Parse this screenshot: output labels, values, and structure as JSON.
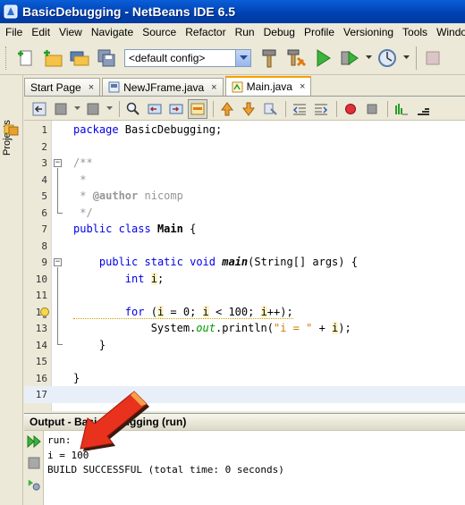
{
  "window": {
    "title": "BasicDebugging - NetBeans IDE 6.5"
  },
  "menu": [
    "File",
    "Edit",
    "View",
    "Navigate",
    "Source",
    "Refactor",
    "Run",
    "Debug",
    "Profile",
    "Versioning",
    "Tools",
    "Window"
  ],
  "toolbar": {
    "config": "<default config>",
    "icons": [
      "new-file-icon",
      "new-project-icon",
      "open-project-icon",
      "save-all-icon",
      "build-hammer-icon",
      "clean-build-icon",
      "run-icon",
      "debug-icon",
      "profile-icon",
      "stop-icon"
    ]
  },
  "sidebar": {
    "projects_label": "Projects"
  },
  "tabs": [
    {
      "label": "Start Page",
      "close": "×",
      "active": false
    },
    {
      "label": "NewJFrame.java",
      "close": "×",
      "active": false
    },
    {
      "label": "Main.java",
      "close": "×",
      "active": true
    }
  ],
  "editor": {
    "lines": [
      {
        "n": "1",
        "html": "package BasicDebugging;"
      },
      {
        "n": "2",
        "html": ""
      },
      {
        "n": "3",
        "html": "/**"
      },
      {
        "n": "4",
        "html": " *"
      },
      {
        "n": "5",
        "html": " * @author nicomp"
      },
      {
        "n": "6",
        "html": " */"
      },
      {
        "n": "7",
        "html": "public class Main {"
      },
      {
        "n": "8",
        "html": ""
      },
      {
        "n": "9",
        "html": "    public static void main(String[] args) {"
      },
      {
        "n": "10",
        "html": "        int i;"
      },
      {
        "n": "11",
        "html": ""
      },
      {
        "n": "12",
        "html": "        for (i = 0; i < 100; i++);"
      },
      {
        "n": "13",
        "html": "            System.out.println(\"i = \" + i);"
      },
      {
        "n": "14",
        "html": "    }"
      },
      {
        "n": "15",
        "html": ""
      },
      {
        "n": "16",
        "html": "}"
      },
      {
        "n": "17",
        "html": ""
      }
    ]
  },
  "output": {
    "title": "Output - BasicDebugging (run)",
    "lines": [
      "run:",
      "i = 100",
      "BUILD SUCCESSFUL (total time: 0 seconds)"
    ]
  },
  "colors": {
    "titlebar": "#0a5fd8",
    "keyword": "#0000e6",
    "comment": "#969696",
    "string": "#ce7b00",
    "field": "#009900",
    "arrow": "#e8321e"
  }
}
